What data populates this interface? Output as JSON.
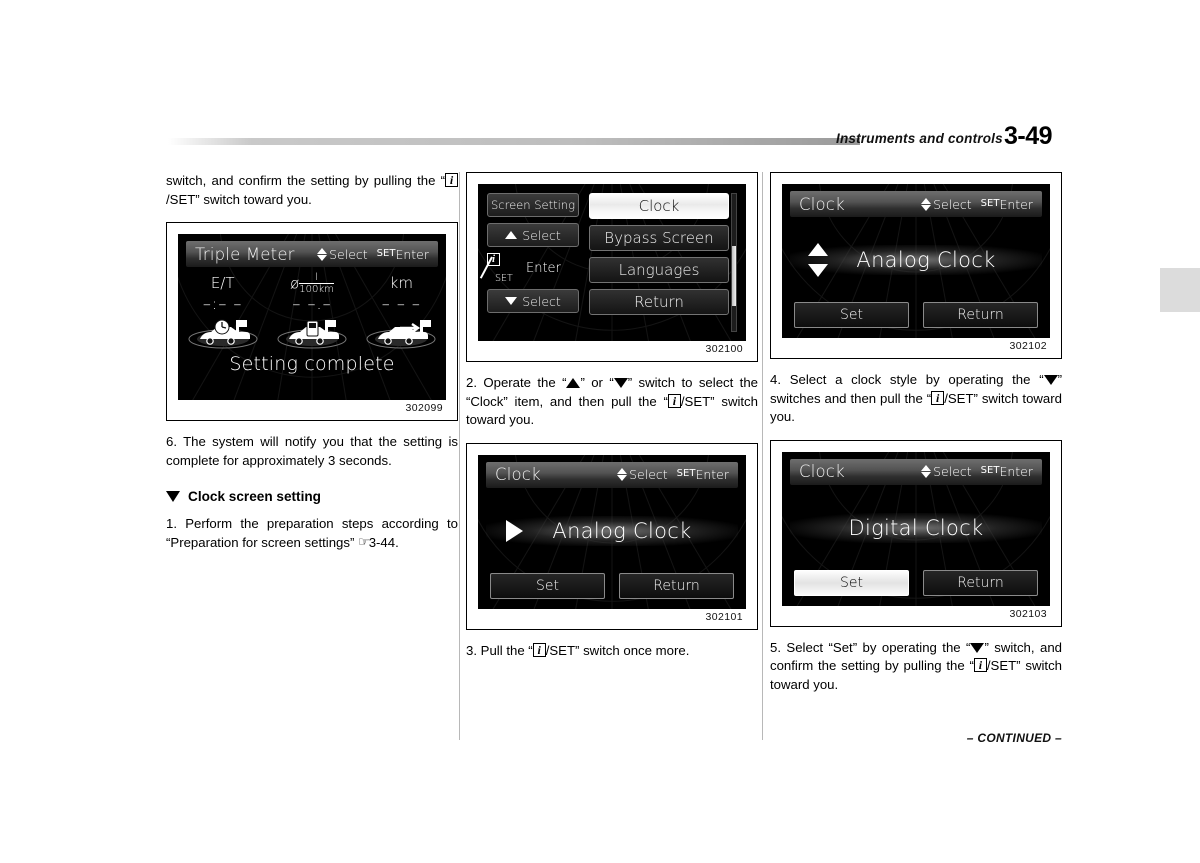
{
  "header": {
    "title": "Instruments and controls",
    "page_number": "3-49"
  },
  "footer": {
    "continued": "– CONTINUED –"
  },
  "column_left": {
    "para_top_a": "switch, and confirm the setting by pulling",
    "para_top_b": "the “",
    "para_top_c": "/SET” switch toward you.",
    "figure": {
      "id": "302099",
      "screen": {
        "title": "Triple Meter",
        "hint_select": "Select",
        "hint_set": "SET",
        "hint_enter": "Enter",
        "cells": [
          {
            "unit": "E/T",
            "value": "–:– –",
            "icon": "car-clock-flag-icon"
          },
          {
            "unit_symbol": "ø",
            "unit_num": "l",
            "unit_den": "100km",
            "value": "– –.–",
            "icon": "car-fuel-flag-icon"
          },
          {
            "unit": "km",
            "value": "– – –",
            "icon": "car-range-flag-icon"
          }
        ],
        "message": "Setting complete"
      }
    },
    "step6": "6.  The system will notify you that the setting is complete for approximately 3 seconds.",
    "section_heading": "Clock screen setting",
    "step1_a": "1.  Perform the preparation steps according to “Preparation for screen settings”",
    "step1_ref": "3-44."
  },
  "column_middle": {
    "figure_menu": {
      "id": "302100",
      "screen": {
        "side_title": "Screen Setting",
        "side_select_up": "Select",
        "side_enter": "Enter",
        "side_set": "SET",
        "side_select_down": "Select",
        "items": [
          {
            "label": "Clock",
            "selected": true
          },
          {
            "label": "Bypass Screen",
            "selected": false
          },
          {
            "label": "Languages",
            "selected": false
          },
          {
            "label": "Return",
            "selected": false
          }
        ]
      }
    },
    "step2_a": "2.  Operate the “",
    "step2_b": "” or “",
    "step2_c": "” switch to select the “Clock” item, and then pull the “",
    "step2_d": "/SET” switch toward you.",
    "figure_clock": {
      "id": "302101",
      "screen": {
        "title": "Clock",
        "hint_select": "Select",
        "hint_set": "SET",
        "hint_enter": "Enter",
        "style_label": "Analog Clock",
        "arrow": "right-triangle-icon",
        "btn_set": "Set",
        "btn_return": "Return",
        "selected_button": "none"
      }
    },
    "step3_a": "3.  Pull the “",
    "step3_b": "/SET” switch once more."
  },
  "column_right": {
    "figure_analog": {
      "id": "302102",
      "screen": {
        "title": "Clock",
        "hint_select": "Select",
        "hint_set": "SET",
        "hint_enter": "Enter",
        "style_label": "Analog Clock",
        "arrow": "up-down-arrow-icon",
        "btn_set": "Set",
        "btn_return": "Return",
        "selected_button": "none"
      }
    },
    "step4_a": "4.  Select a clock style by operating the “",
    "step4_b": "” switches and then pull the “",
    "step4_c": "/SET” switch toward you.",
    "figure_digital": {
      "id": "302103",
      "screen": {
        "title": "Clock",
        "hint_select": "Select",
        "hint_set": "SET",
        "hint_enter": "Enter",
        "style_label": "Digital Clock",
        "arrow": "none",
        "btn_set": "Set",
        "btn_return": "Return",
        "selected_button": "Set"
      }
    },
    "step5_a": "5.  Select “Set” by operating the “",
    "step5_b": "” switch, and confirm the setting by pulling the “",
    "step5_c": "/SET” switch toward you."
  }
}
